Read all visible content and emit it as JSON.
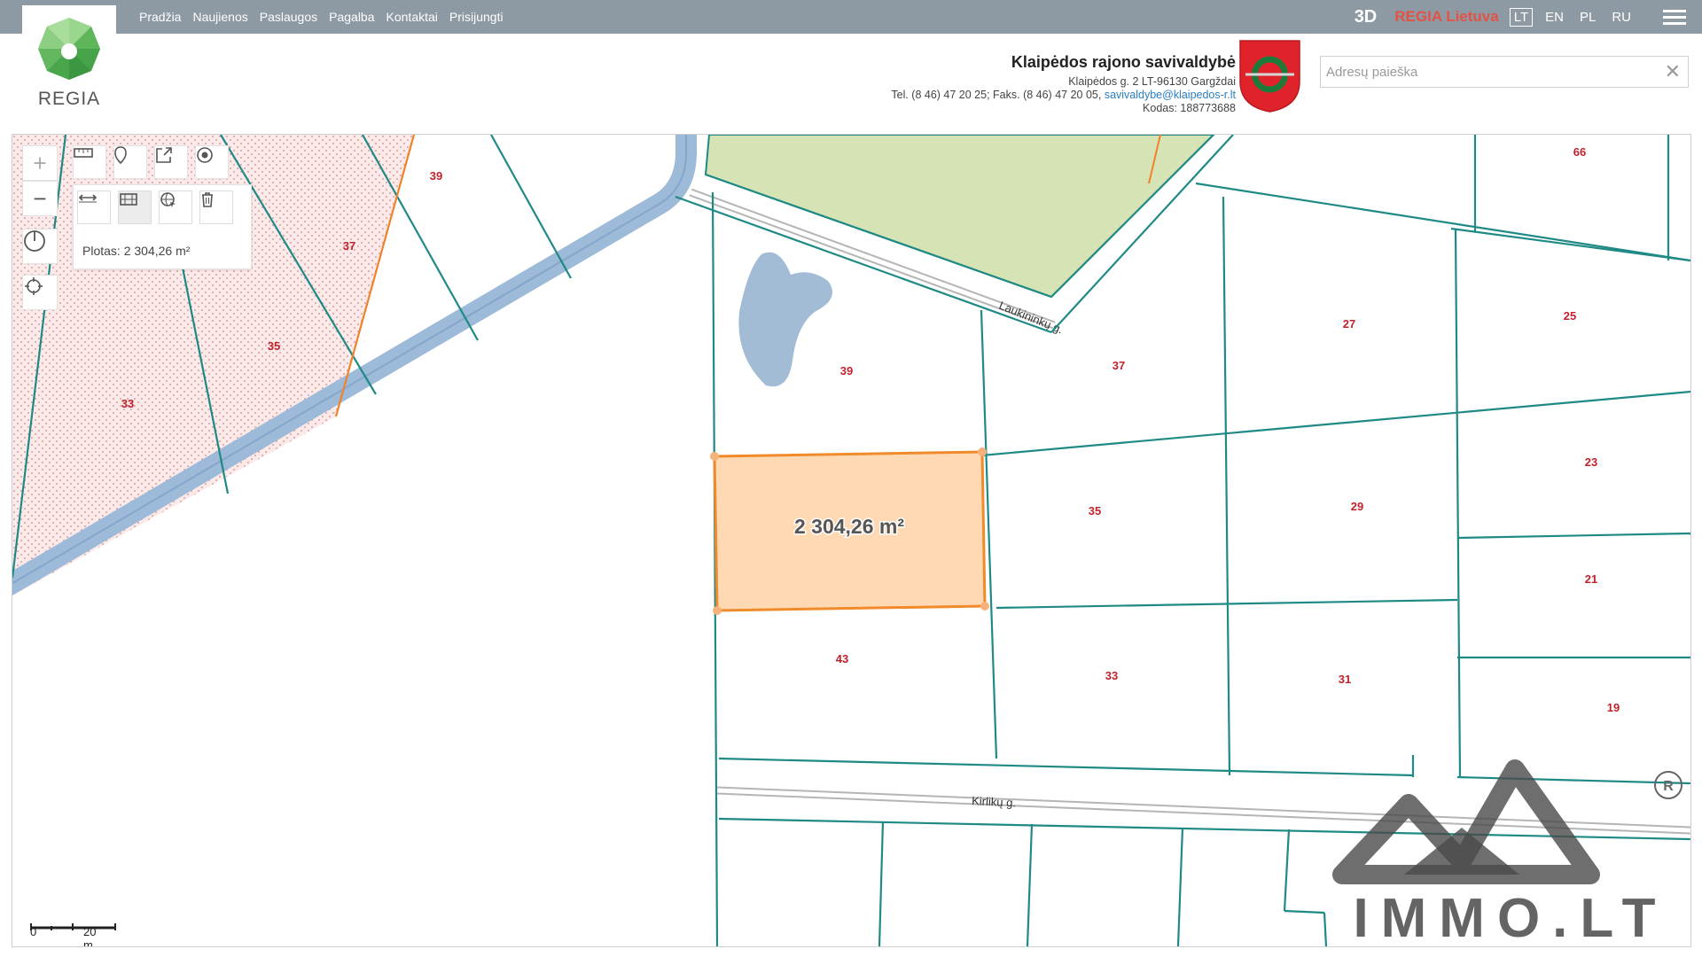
{
  "nav": {
    "items": [
      "Pradžia",
      "Naujienos",
      "Paslaugos",
      "Pagalba",
      "Kontaktai",
      "Prisijungti"
    ]
  },
  "header": {
    "btn_3d": "3D",
    "regia_lietuva": "REGIA Lietuva",
    "languages": [
      "LT",
      "EN",
      "PL",
      "RU"
    ],
    "active_language": "LT",
    "logo_text": "REGIA",
    "org_name": "Klaipėdos rajono savivaldybė",
    "org_address": "Klaipėdos g. 2 LT-96130 Gargždai",
    "org_phone": "Tel. (8 46) 47 20 25; Faks. (8 46) 47 20 05,",
    "org_email": "savivaldybe@klaipedos-r.lt",
    "org_code": "Kodas: 188773688"
  },
  "search": {
    "placeholder": "Adresų paieška",
    "value": ""
  },
  "tools": {
    "measure_result": "Plotas: 2 304,26 m²"
  },
  "map": {
    "selected_area_label": "2 304,26 m²",
    "streets": [
      "Laukininkų g.",
      "Kirlikų g."
    ],
    "parcel_numbers": [
      "39",
      "37",
      "35",
      "33",
      "39",
      "37",
      "35",
      "43",
      "33",
      "27",
      "29",
      "31",
      "66",
      "25",
      "23",
      "21",
      "19",
      "33",
      "39"
    ],
    "scale_start": "0",
    "scale_end": "20 m",
    "watermark": "IMMO.LT",
    "colors": {
      "parcel_line": "#1f8a85",
      "label": "#c0222c",
      "river": "#9dbad8",
      "protected_hatch": "#f4cdcd",
      "green_zone": "#d5e3b5",
      "selection_fill": "#ffd9b3",
      "selection_stroke": "#f08a2b",
      "brand_green": "#4caf50"
    }
  }
}
